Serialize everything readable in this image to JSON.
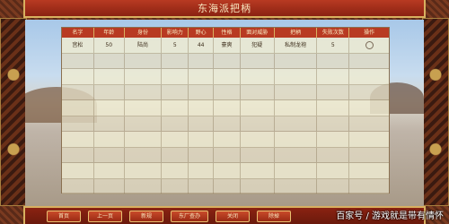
{
  "window": {
    "title": "东海派把柄"
  },
  "table": {
    "headers": [
      "名字",
      "年龄",
      "身份",
      "影响力",
      "野心",
      "性格",
      "面对威胁",
      "把柄",
      "失败次数",
      "操作"
    ],
    "rows": [
      [
        "宫松",
        "50",
        "陆尚",
        "5",
        "44",
        "豪爽",
        "犯疑",
        "私制龙袍",
        "5",
        ""
      ],
      [
        "",
        "",
        "",
        "",
        "",
        "",
        "",
        "",
        "",
        ""
      ],
      [
        "",
        "",
        "",
        "",
        "",
        "",
        "",
        "",
        "",
        ""
      ],
      [
        "",
        "",
        "",
        "",
        "",
        "",
        "",
        "",
        "",
        ""
      ],
      [
        "",
        "",
        "",
        "",
        "",
        "",
        "",
        "",
        "",
        ""
      ],
      [
        "",
        "",
        "",
        "",
        "",
        "",
        "",
        "",
        "",
        ""
      ],
      [
        "",
        "",
        "",
        "",
        "",
        "",
        "",
        "",
        "",
        ""
      ],
      [
        "",
        "",
        "",
        "",
        "",
        "",
        "",
        "",
        "",
        ""
      ],
      [
        "",
        "",
        "",
        "",
        "",
        "",
        "",
        "",
        "",
        ""
      ],
      [
        "",
        "",
        "",
        "",
        "",
        "",
        "",
        "",
        "",
        ""
      ]
    ]
  },
  "buttons": {
    "first": "首页",
    "prev": "上一页",
    "next": "新规",
    "east": "东厂查办",
    "close": "关闭",
    "kill": "除掉"
  },
  "watermark": "百家号 / 游戏就是带有情怀",
  "colors": {
    "accent": "#b83a22",
    "border": "#d8b060"
  }
}
